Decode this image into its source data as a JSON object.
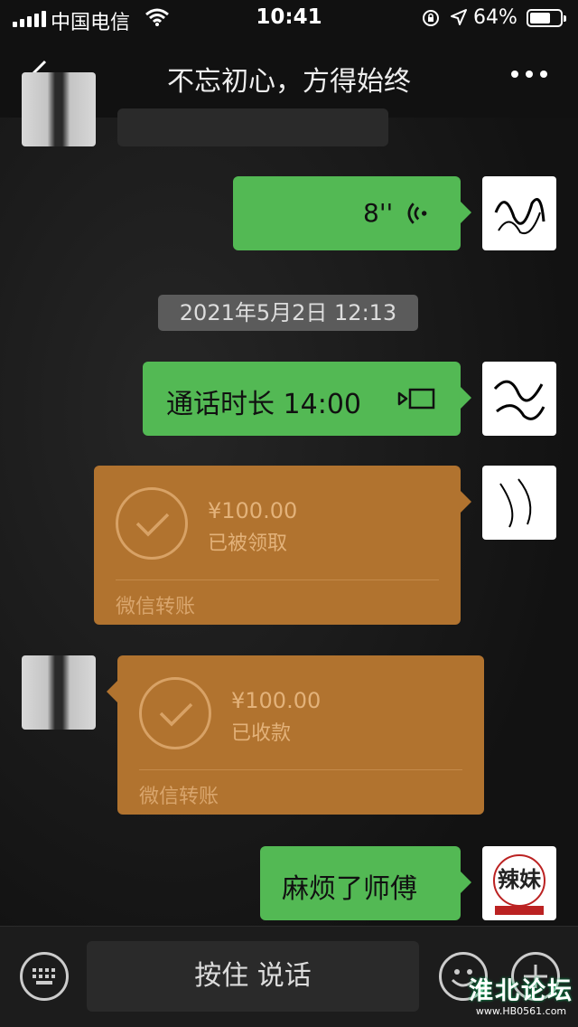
{
  "status_bar": {
    "carrier": "中国电信",
    "time": "10:41",
    "battery": "64%"
  },
  "nav": {
    "title": "不忘初心，方得始终"
  },
  "messages": {
    "voice_duration": "8''",
    "timestamp": "2021年5月2日 12:13",
    "call_text": "通话时长 14:00",
    "transfer_sent": {
      "amount": "¥100.00",
      "status": "已被领取",
      "footer": "微信转账"
    },
    "transfer_received": {
      "amount": "¥100.00",
      "status": "已收款",
      "footer": "微信转账"
    },
    "last_text": "麻烦了师傅",
    "brand_avatar_text": "辣妹"
  },
  "input_bar": {
    "voice_button_label": "按住 说话"
  },
  "watermark": {
    "name": "淮北论坛",
    "url": "www.HB0561.com"
  },
  "colors": {
    "bubble_green": "#53b954",
    "transfer_orange": "#b1732f",
    "background": "#151515"
  },
  "icons": [
    "signal-icon",
    "wifi-icon",
    "rotation-lock-icon",
    "location-icon",
    "battery-icon",
    "back-icon",
    "more-icon",
    "voice-wave-icon",
    "video-call-icon",
    "check-circle-icon",
    "keyboard-icon",
    "emoji-icon",
    "plus-icon"
  ]
}
